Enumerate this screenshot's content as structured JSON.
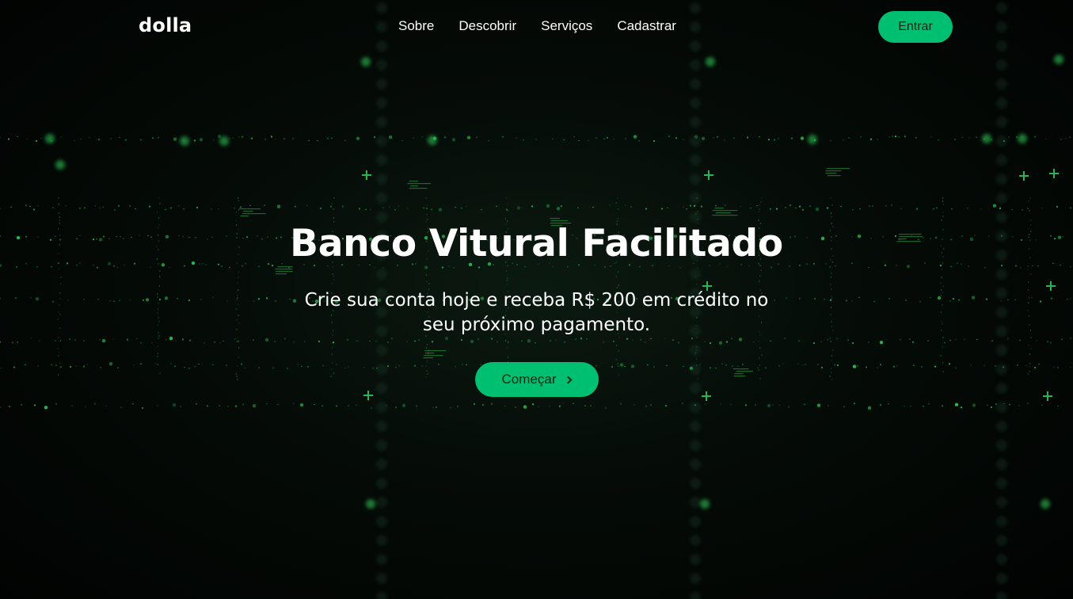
{
  "navbar": {
    "logo": "dolla",
    "links": [
      "Sobre",
      "Descobrir",
      "Serviços",
      "Cadastrar"
    ],
    "cta": "Entrar"
  },
  "hero": {
    "title": "Banco Vitural Facilitado",
    "subtitle": "Crie sua conta hoje e receba R$ 200 em crédito no seu próximo pagamento.",
    "button": "Começar",
    "button_icon": "chevron-right-icon"
  },
  "colors": {
    "accent": "#01bf71",
    "background": "#010302",
    "particles": "#2fd35a"
  }
}
